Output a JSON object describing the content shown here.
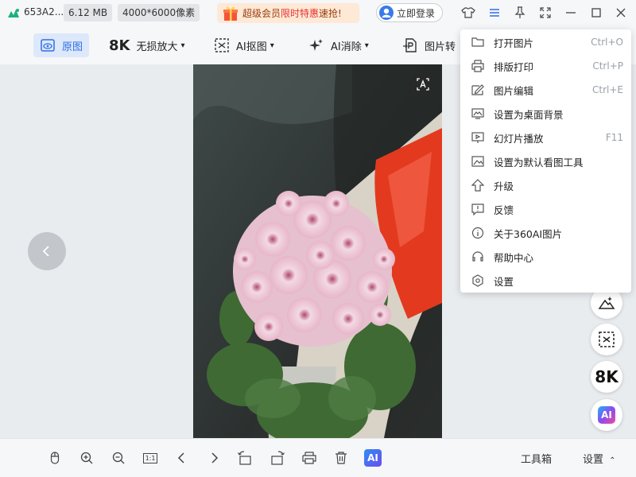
{
  "title_bar": {
    "file_name": "653A2...",
    "file_size": "6.12 MB",
    "dimensions": "4000*6000像素",
    "promo": {
      "prefix": "超级会员",
      "highlight": "限时特惠",
      "suffix": "速抢!"
    },
    "login_label": "立即登录"
  },
  "toolbar": {
    "original": "原图",
    "upscale_badge": "8K",
    "upscale": "无损放大",
    "cutout": "AI抠图",
    "erase": "AI消除",
    "convert": "图片转"
  },
  "menu": {
    "items": [
      {
        "label": "打开图片",
        "shortcut": "Ctrl+O"
      },
      {
        "label": "排版打印",
        "shortcut": "Ctrl+P"
      },
      {
        "label": "图片编辑",
        "shortcut": "Ctrl+E"
      },
      {
        "label": "设置为桌面背景",
        "shortcut": ""
      },
      {
        "label": "幻灯片播放",
        "shortcut": "F11"
      },
      {
        "label": "设置为默认看图工具",
        "shortcut": ""
      },
      {
        "label": "升级",
        "shortcut": ""
      },
      {
        "label": "反馈",
        "shortcut": ""
      },
      {
        "label": "关于360AI图片",
        "shortcut": ""
      },
      {
        "label": "帮助中心",
        "shortcut": ""
      },
      {
        "label": "设置",
        "shortcut": ""
      }
    ]
  },
  "side_tools": {
    "upscale_label": "8K",
    "ai_label": "AI"
  },
  "bottom_bar": {
    "zoom_reset": "1:1",
    "ai_label": "AI",
    "toolbox": "工具箱",
    "settings": "设置"
  },
  "colors": {
    "accent": "#2f6fe4",
    "promo_highlight": "#e8312f",
    "promo_bg": "#fde9d6"
  }
}
